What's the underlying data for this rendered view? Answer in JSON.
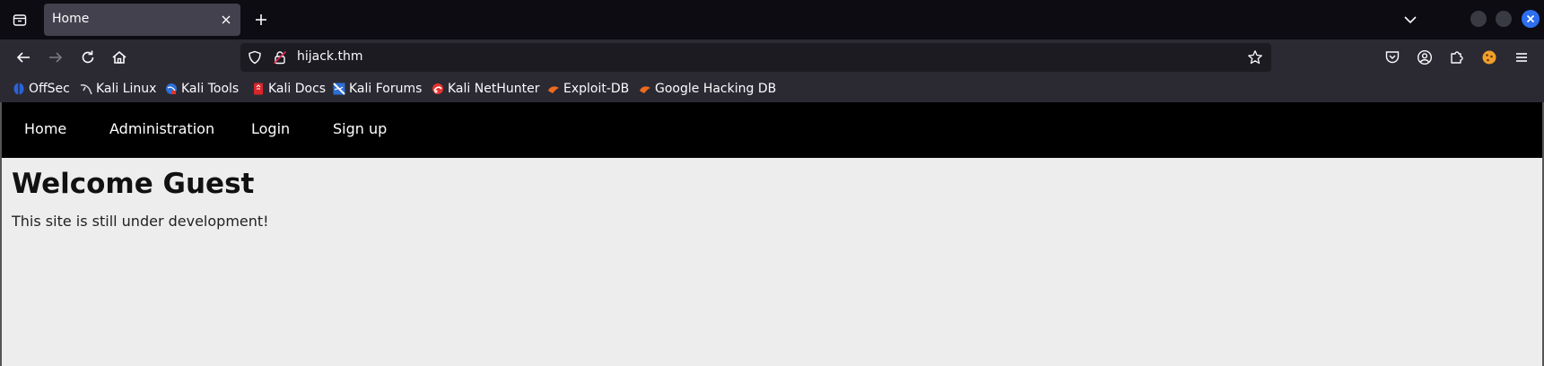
{
  "browser": {
    "tab": {
      "title": "Home"
    },
    "url": "hijack.thm"
  },
  "bookmarks": [
    {
      "label": "OffSec",
      "icon": "offsec-icon"
    },
    {
      "label": "Kali Linux",
      "icon": "kali-linux-icon"
    },
    {
      "label": "Kali Tools",
      "icon": "kali-tools-icon"
    },
    {
      "label": "Kali Docs",
      "icon": "kali-docs-icon"
    },
    {
      "label": "Kali Forums",
      "icon": "kali-forums-icon"
    },
    {
      "label": "Kali NetHunter",
      "icon": "kali-nethunter-icon"
    },
    {
      "label": "Exploit-DB",
      "icon": "exploit-db-icon"
    },
    {
      "label": "Google Hacking DB",
      "icon": "google-hacking-db-icon"
    }
  ],
  "site": {
    "nav": [
      {
        "label": "Home"
      },
      {
        "label": "Administration"
      },
      {
        "label": "Login"
      },
      {
        "label": "Sign up"
      }
    ],
    "heading": "Welcome Guest",
    "message": "This site is still under development!"
  },
  "colors": {
    "tabstrip": "#0c0c12",
    "toolbar": "#2b2a33",
    "site_nav": "#000000",
    "page_bg": "#ededed",
    "window_close": "#2e6ef0"
  }
}
